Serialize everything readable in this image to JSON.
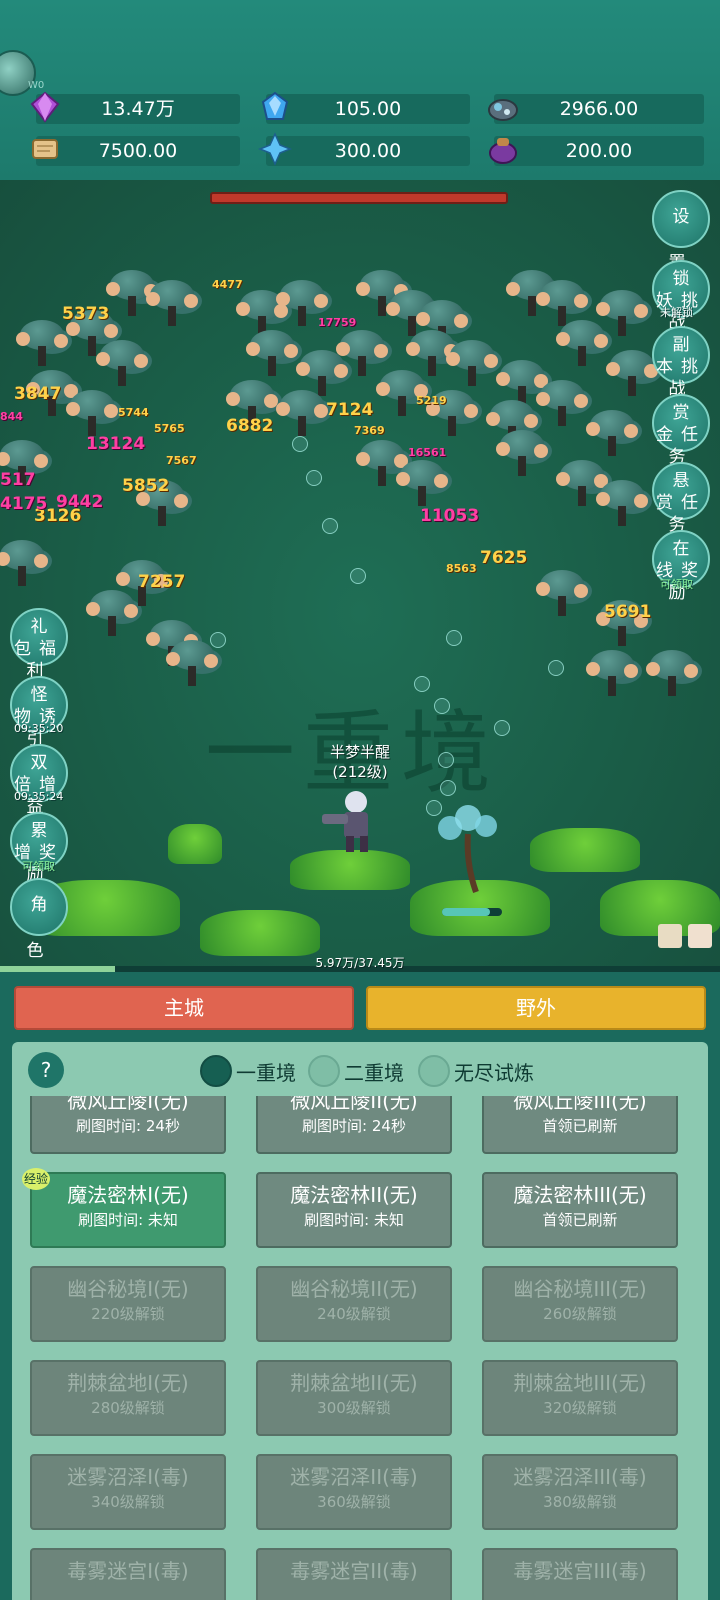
{
  "avatar": {
    "label": "W0"
  },
  "resources": [
    {
      "icon": "purple-gem-icon",
      "value": "13.47万"
    },
    {
      "icon": "blue-crystal-icon",
      "value": "105.00"
    },
    {
      "icon": "ore-icon",
      "value": "2966.00"
    },
    {
      "icon": "scroll-icon",
      "value": "7500.00"
    },
    {
      "icon": "ice-shard-icon",
      "value": "300.00"
    },
    {
      "icon": "purple-pouch-icon",
      "value": "200.00"
    }
  ],
  "field": {
    "watermark": "一重境",
    "damage_numbers": [
      "5373",
      "4477",
      "17759",
      "3847",
      "5744",
      "5765",
      "13124",
      "7567",
      "6882",
      "7124",
      "7369",
      "5219",
      "16561",
      "11053",
      "5852",
      "9442",
      "3126",
      "4175",
      "517",
      "844",
      "7257",
      "8563",
      "7625",
      "5691"
    ],
    "hero": {
      "name": "半梦半醒",
      "level": "(212级)"
    }
  },
  "right_buttons": [
    {
      "label": "设置"
    },
    {
      "label": "锁妖挑战",
      "sub": "未解锁"
    },
    {
      "label": "副本挑战"
    },
    {
      "label": "赏金任务"
    },
    {
      "label": "悬赏任务"
    },
    {
      "label": "在线奖励",
      "sub": "可领取"
    }
  ],
  "left_buttons": [
    {
      "label": "礼包福利"
    },
    {
      "label": "怪物诱引",
      "sub": "09:35:20"
    },
    {
      "label": "双倍增益",
      "sub": "09:35:24"
    },
    {
      "label": "累增奖励",
      "sub": "可领取"
    },
    {
      "label": "角色"
    }
  ],
  "exp": {
    "text": "5.97万/37.45万",
    "progress": 0.16
  },
  "tabs": {
    "main_city": "主城",
    "wild": "野外"
  },
  "panel": {
    "help": "?",
    "realms": [
      {
        "label": "一重境",
        "selected": true
      },
      {
        "label": "二重境",
        "selected": false
      },
      {
        "label": "无尽试炼",
        "selected": false
      }
    ],
    "maps": [
      [
        {
          "name": "微风丘陵I(无)",
          "sub": "刷图时间: 24秒"
        },
        {
          "name": "微风丘陵II(无)",
          "sub": "刷图时间: 24秒"
        },
        {
          "name": "微风丘陵III(无)",
          "sub": "首领已刷新"
        }
      ],
      [
        {
          "name": "魔法密林I(无)",
          "sub": "刷图时间: 未知",
          "badge": "经验"
        },
        {
          "name": "魔法密林II(无)",
          "sub": "刷图时间: 未知"
        },
        {
          "name": "魔法密林III(无)",
          "sub": "首领已刷新"
        }
      ],
      [
        {
          "name": "幽谷秘境I(无)",
          "sub": "220级解锁"
        },
        {
          "name": "幽谷秘境II(无)",
          "sub": "240级解锁"
        },
        {
          "name": "幽谷秘境III(无)",
          "sub": "260级解锁"
        }
      ],
      [
        {
          "name": "荆棘盆地I(无)",
          "sub": "280级解锁"
        },
        {
          "name": "荆棘盆地II(无)",
          "sub": "300级解锁"
        },
        {
          "name": "荆棘盆地III(无)",
          "sub": "320级解锁"
        }
      ],
      [
        {
          "name": "迷雾沼泽I(毒)",
          "sub": "340级解锁"
        },
        {
          "name": "迷雾沼泽II(毒)",
          "sub": "360级解锁"
        },
        {
          "name": "迷雾沼泽III(毒)",
          "sub": "380级解锁"
        }
      ],
      [
        {
          "name": "毒雾迷宫I(毒)",
          "sub": ""
        },
        {
          "name": "毒雾迷宫II(毒)",
          "sub": ""
        },
        {
          "name": "毒雾迷宫III(毒)",
          "sub": ""
        }
      ]
    ]
  }
}
